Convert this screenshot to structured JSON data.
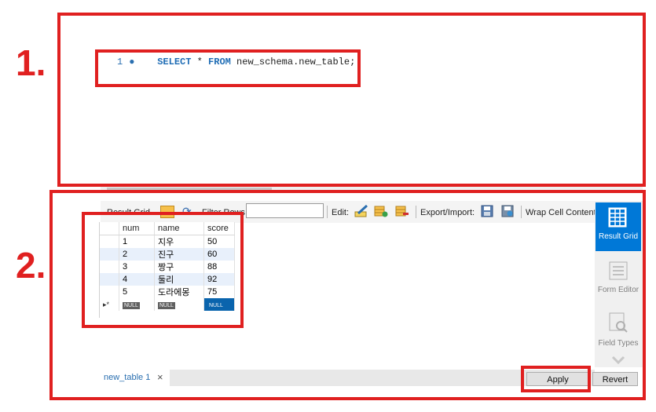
{
  "labels": {
    "step1": "1.",
    "step2": "2."
  },
  "editor": {
    "line_number": "1",
    "kw_select": "SELECT",
    "star": " * ",
    "kw_from": "FROM",
    "target": " new_schema.new_table;"
  },
  "toolbar": {
    "result_grid_label": "Result Grid",
    "filter_rows_label": "Filter Rows:",
    "filter_value": "",
    "edit_label": "Edit:",
    "export_label": "Export/Import:",
    "wrap_label": "Wrap Cell Content:"
  },
  "grid": {
    "columns": [
      "num",
      "name",
      "score"
    ],
    "rows": [
      [
        "1",
        "지우",
        "50"
      ],
      [
        "2",
        "진구",
        "60"
      ],
      [
        "3",
        "짱구",
        "88"
      ],
      [
        "4",
        "둘리",
        "92"
      ],
      [
        "5",
        "도라에몽",
        "75"
      ]
    ],
    "null_label": "NULL",
    "new_row_marker": "▸*"
  },
  "side_panel": {
    "result_grid": "Result Grid",
    "form_editor": "Form Editor",
    "field_types": "Field Types"
  },
  "tabs": {
    "active_tab": "new_table 1",
    "close_symbol": "×"
  },
  "buttons": {
    "apply": "Apply",
    "revert": "Revert"
  },
  "colors": {
    "annotation_red": "#e02020",
    "accent_blue": "#0078d7",
    "selected_blue": "#0a64ad"
  }
}
